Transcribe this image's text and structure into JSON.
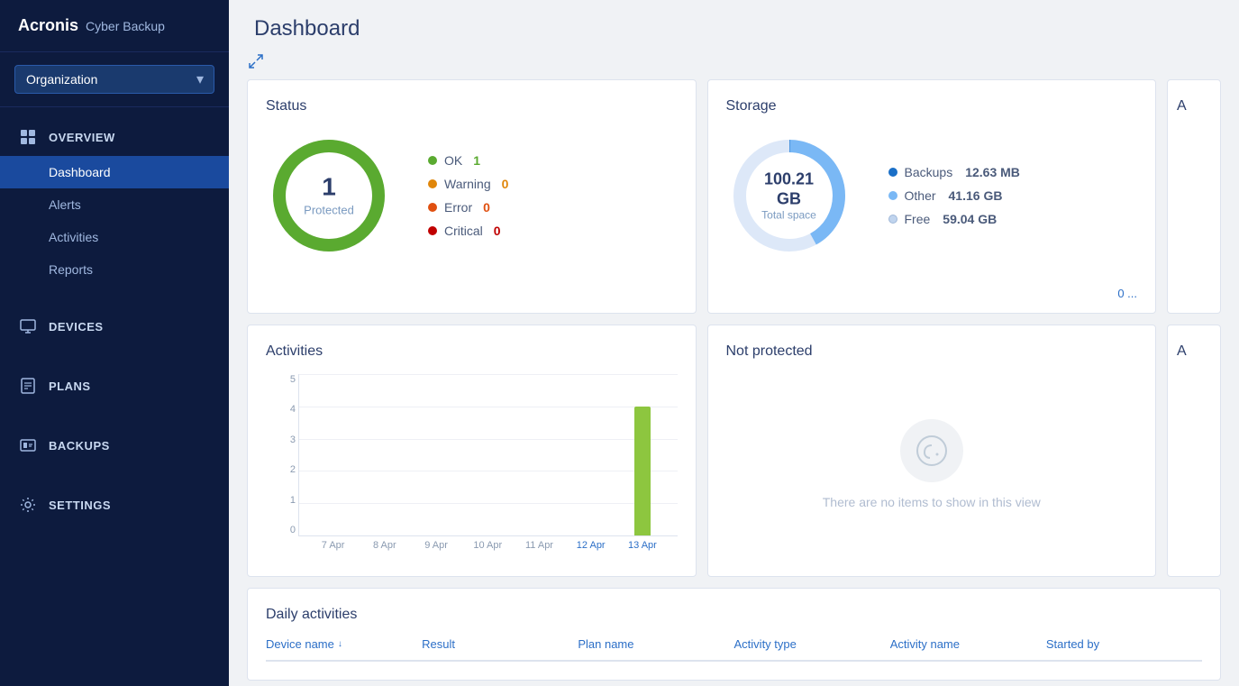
{
  "app": {
    "brand": "Acronis",
    "product": "Cyber Backup"
  },
  "org_selector": {
    "value": "Organization",
    "options": [
      "Organization"
    ]
  },
  "sidebar": {
    "nav_groups": [
      {
        "id": "overview",
        "label": "OVERVIEW",
        "icon": "grid-icon",
        "items": [
          {
            "id": "dashboard",
            "label": "Dashboard",
            "active": true
          },
          {
            "id": "alerts",
            "label": "Alerts",
            "active": false
          },
          {
            "id": "activities",
            "label": "Activities",
            "active": false
          },
          {
            "id": "reports",
            "label": "Reports",
            "active": false
          }
        ]
      },
      {
        "id": "devices",
        "label": "DEVICES",
        "icon": "monitor-icon",
        "items": []
      },
      {
        "id": "plans",
        "label": "PLANS",
        "icon": "plans-icon",
        "items": []
      },
      {
        "id": "backups",
        "label": "BACKUPS",
        "icon": "backups-icon",
        "items": []
      },
      {
        "id": "settings",
        "label": "SETTINGS",
        "icon": "gear-icon",
        "items": []
      }
    ]
  },
  "main": {
    "title": "Dashboard"
  },
  "status_card": {
    "title": "Status",
    "count": "1",
    "label": "Protected",
    "legend": [
      {
        "id": "ok",
        "label": "OK",
        "value": "1",
        "color": "#5aaa30"
      },
      {
        "id": "warning",
        "label": "Warning",
        "value": "0",
        "color": "#e0860a"
      },
      {
        "id": "error",
        "label": "Error",
        "value": "0",
        "color": "#e05010"
      },
      {
        "id": "critical",
        "label": "Critical",
        "value": "0",
        "color": "#c00000"
      }
    ],
    "donut_color": "#5aaa30",
    "donut_bg": "#e8f5e0"
  },
  "storage_card": {
    "title": "Storage",
    "total": "100.21 GB",
    "sublabel": "Total space",
    "legend": [
      {
        "id": "backups",
        "label": "Backups",
        "value": "12.63 MB",
        "color": "#1a6fc7"
      },
      {
        "id": "other",
        "label": "Other",
        "value": "41.16 GB",
        "color": "#7ab8f5"
      },
      {
        "id": "free",
        "label": "Free",
        "value": "59.04 GB",
        "color": "#dde8f8"
      }
    ],
    "link": "0 ..."
  },
  "activities_card": {
    "title": "Activities",
    "y_labels": [
      "5",
      "4",
      "3",
      "2",
      "1",
      "0"
    ],
    "bars": [
      {
        "date": "7 Apr",
        "value": 0,
        "max": 5
      },
      {
        "date": "8 Apr",
        "value": 0,
        "max": 5
      },
      {
        "date": "9 Apr",
        "value": 0,
        "max": 5
      },
      {
        "date": "10 Apr",
        "value": 0,
        "max": 5
      },
      {
        "date": "11 Apr",
        "value": 0,
        "max": 5
      },
      {
        "date": "12 Apr",
        "value": 0,
        "max": 5,
        "highlight": true
      },
      {
        "date": "13 Apr",
        "value": 4,
        "max": 5,
        "highlight": true
      }
    ]
  },
  "not_protected_card": {
    "title": "Not protected",
    "empty_message": "There are no items to show in this view"
  },
  "daily_activities": {
    "title": "Daily activities",
    "columns": [
      {
        "id": "device_name",
        "label": "Device name",
        "sortable": true
      },
      {
        "id": "result",
        "label": "Result",
        "sortable": false
      },
      {
        "id": "plan_name",
        "label": "Plan name",
        "sortable": false
      },
      {
        "id": "activity_type",
        "label": "Activity type",
        "sortable": false
      },
      {
        "id": "activity_name",
        "label": "Activity name",
        "sortable": false
      },
      {
        "id": "started_by",
        "label": "Started by",
        "sortable": false
      }
    ]
  },
  "partial_card": {
    "title": "A"
  }
}
